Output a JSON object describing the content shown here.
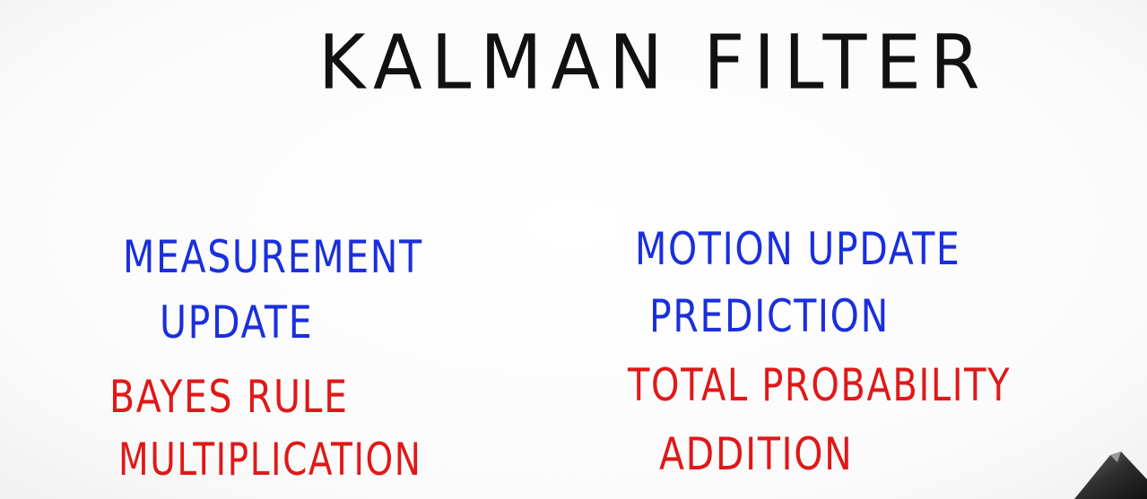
{
  "board": {
    "title": "KALMAN FILTER",
    "left_column": {
      "line1": "MEASUREMENT",
      "line2": "UPDATE",
      "line3": "BAYES RULE",
      "line4": "MULTIPLICATION"
    },
    "right_column": {
      "line1": "MOTION UPDATE",
      "line2": "PREDICTION",
      "line3": "TOTAL PROBABILITY",
      "line4": "ADDITION"
    }
  },
  "colors": {
    "title_ink": "#111111",
    "blue_ink": "#1a2fdc",
    "red_ink": "#e01818",
    "background": "#ffffff"
  },
  "icons": {
    "pen_tip": "pen-tip-icon"
  }
}
